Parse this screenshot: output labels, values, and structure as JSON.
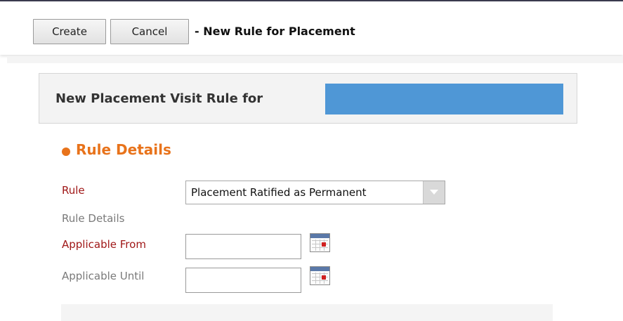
{
  "toolbar": {
    "create_label": "Create",
    "cancel_label": "Cancel",
    "title": "- New Rule for Placement"
  },
  "header": {
    "title": "New Placement Visit Rule for"
  },
  "section": {
    "title": "Rule Details"
  },
  "form": {
    "rule_label": "Rule",
    "rule_value": "Placement Ratified as Permanent",
    "rule_details_label": "Rule Details",
    "applicable_from_label": "Applicable From",
    "applicable_from_value": "",
    "applicable_until_label": "Applicable Until",
    "applicable_until_value": ""
  },
  "icons": {
    "select_arrow": "chevron-down-icon",
    "calendar": "calendar-icon"
  },
  "colors": {
    "accent": "#e8731b",
    "required_label": "#a01818",
    "optional_label": "#7a7a7a",
    "redacted_block": "#4f97d6"
  }
}
